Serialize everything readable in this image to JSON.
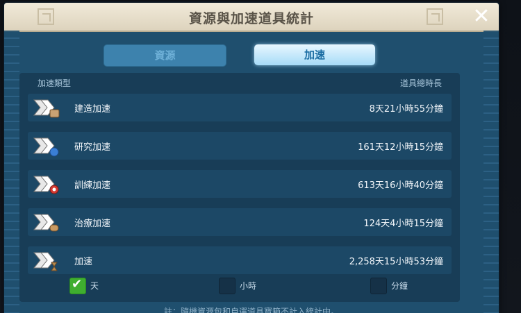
{
  "window": {
    "title": "資源與加速道具統計",
    "close_glyph": "✕"
  },
  "tabs": [
    {
      "label": "資源",
      "active": false
    },
    {
      "label": "加速",
      "active": true
    }
  ],
  "table": {
    "headers": {
      "type": "加速類型",
      "total": "道具總時長"
    },
    "rows": [
      {
        "icon": "building-speedup-icon",
        "label": "建造加速",
        "value": "8天21小時55分鐘",
        "badge_color": "#c9a274"
      },
      {
        "icon": "research-speedup-icon",
        "label": "研究加速",
        "value": "161天12小時15分鐘",
        "badge_color": "#3a7fd6"
      },
      {
        "icon": "training-speedup-icon",
        "label": "訓練加速",
        "value": "613天16小時40分鐘",
        "badge_color": "#d43a32"
      },
      {
        "icon": "healing-speedup-icon",
        "label": "治療加速",
        "value": "124天4小時15分鐘",
        "badge_color": "#c99a62"
      },
      {
        "icon": "universal-speedup-icon",
        "label": "加速",
        "value": "2,258天15小時53分鐘",
        "badge_color": "#b48a4e"
      }
    ]
  },
  "units": [
    {
      "label": "天",
      "checked": true
    },
    {
      "label": "小時",
      "checked": false
    },
    {
      "label": "分鐘",
      "checked": false
    }
  ],
  "footer_note": "註：隨機資源包和自選道具寶箱不計入統計中。"
}
